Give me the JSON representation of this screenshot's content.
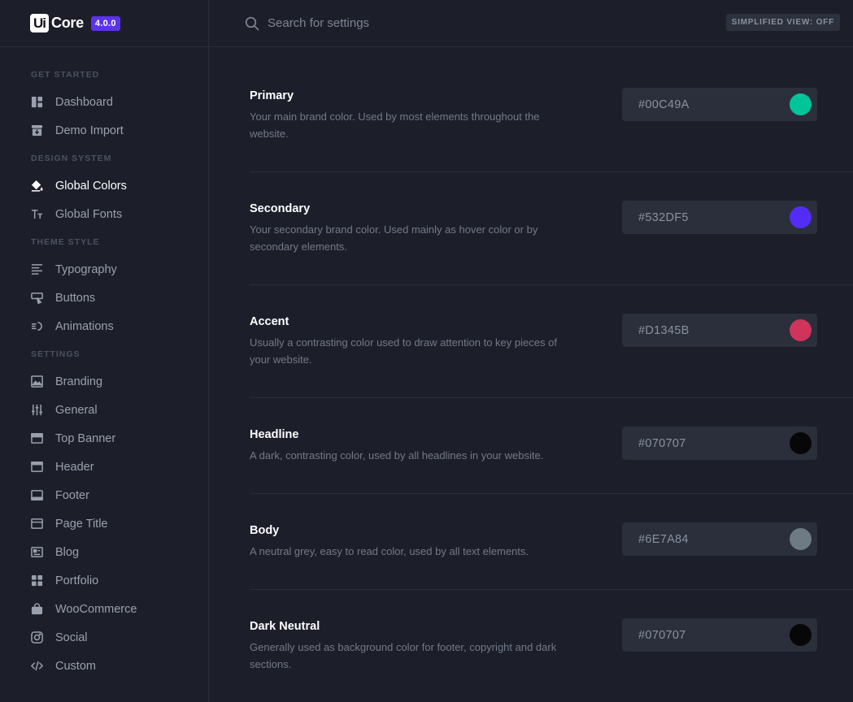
{
  "brand": {
    "logo_mark": "Ui",
    "logo_text": "Core",
    "version": "4.0.0"
  },
  "search": {
    "placeholder": "Search for settings"
  },
  "simplified_view": "SIMPLIFIED VIEW: OFF",
  "sidebar": {
    "groups": [
      {
        "label": "GET STARTED",
        "items": [
          {
            "label": "Dashboard",
            "icon": "dashboard-icon"
          },
          {
            "label": "Demo Import",
            "icon": "import-icon"
          }
        ]
      },
      {
        "label": "DESIGN SYSTEM",
        "items": [
          {
            "label": "Global Colors",
            "icon": "paint-bucket-icon",
            "active": true
          },
          {
            "label": "Global Fonts",
            "icon": "font-icon"
          }
        ]
      },
      {
        "label": "THEME STYLE",
        "items": [
          {
            "label": "Typography",
            "icon": "typography-icon"
          },
          {
            "label": "Buttons",
            "icon": "button-icon"
          },
          {
            "label": "Animations",
            "icon": "animation-icon"
          }
        ]
      },
      {
        "label": "SETTINGS",
        "items": [
          {
            "label": "Branding",
            "icon": "image-icon"
          },
          {
            "label": "General",
            "icon": "sliders-icon"
          },
          {
            "label": "Top Banner",
            "icon": "top-banner-icon"
          },
          {
            "label": "Header",
            "icon": "header-icon"
          },
          {
            "label": "Footer",
            "icon": "footer-icon"
          },
          {
            "label": "Page Title",
            "icon": "page-title-icon"
          },
          {
            "label": "Blog",
            "icon": "blog-icon"
          },
          {
            "label": "Portfolio",
            "icon": "portfolio-icon"
          },
          {
            "label": "WooCommerce",
            "icon": "bag-icon"
          },
          {
            "label": "Social",
            "icon": "instagram-icon"
          },
          {
            "label": "Custom",
            "icon": "code-icon"
          }
        ]
      }
    ]
  },
  "colors": [
    {
      "name": "Primary",
      "description": "Your main brand color. Used by most elements throughout the website.",
      "hex": "#00C49A"
    },
    {
      "name": "Secondary",
      "description": "Your secondary brand color. Used mainly as hover color or by secondary elements.",
      "hex": "#532DF5"
    },
    {
      "name": "Accent",
      "description": "Usually a contrasting color used to draw attention to key pieces of your website.",
      "hex": "#D1345B"
    },
    {
      "name": "Headline",
      "description": "A dark, contrasting color, used by all headlines in your website.",
      "hex": "#070707"
    },
    {
      "name": "Body",
      "description": "A neutral grey, easy to read color, used by all text elements.",
      "hex": "#6E7A84"
    },
    {
      "name": "Dark Neutral",
      "description": "Generally used as background color for footer, copyright and dark sections.",
      "hex": "#070707"
    }
  ],
  "theme_colors": {
    "background": "#1c1f2a",
    "field": "#2a2f3b",
    "badge": "#5b33e8",
    "text_muted": "#9aa0ad"
  }
}
